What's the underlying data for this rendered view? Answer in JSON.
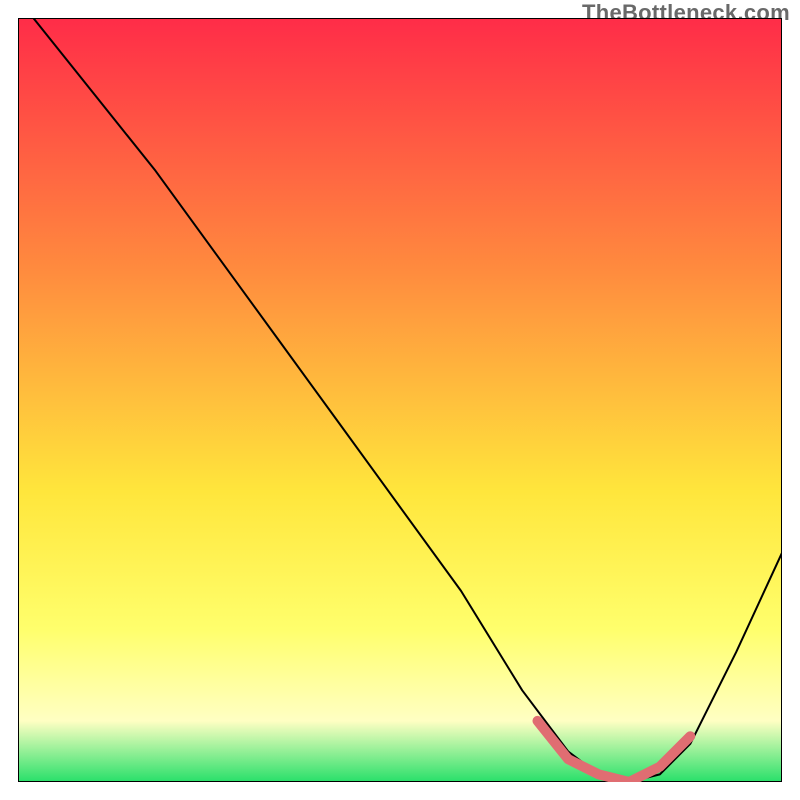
{
  "watermark": "TheBottleneck.com",
  "chart_data": {
    "type": "line",
    "title": "",
    "xlabel": "",
    "ylabel": "",
    "xlim": [
      0,
      100
    ],
    "ylim": [
      0,
      100
    ],
    "grid": false,
    "legend": false,
    "background_gradient": {
      "top": "#ff2c48",
      "mid_upper": "#ff8b3e",
      "mid": "#ffe63c",
      "lower": "#ffff6c",
      "pale": "#ffffc3",
      "bottom": "#28e06a"
    },
    "series": [
      {
        "name": "bottleneck-curve",
        "color": "#000000",
        "width": 2,
        "x": [
          2,
          10,
          18,
          26,
          34,
          42,
          50,
          58,
          66,
          72,
          76,
          80,
          84,
          88,
          94,
          100
        ],
        "y": [
          100,
          90,
          80,
          69,
          58,
          47,
          36,
          25,
          12,
          4,
          1,
          0,
          1,
          5,
          17,
          30
        ]
      },
      {
        "name": "optimal-range-highlight",
        "color": "#e06d72",
        "width": 10,
        "x": [
          68,
          72,
          76,
          80,
          84,
          88
        ],
        "y": [
          8,
          3,
          1,
          0,
          2,
          6
        ]
      }
    ]
  }
}
